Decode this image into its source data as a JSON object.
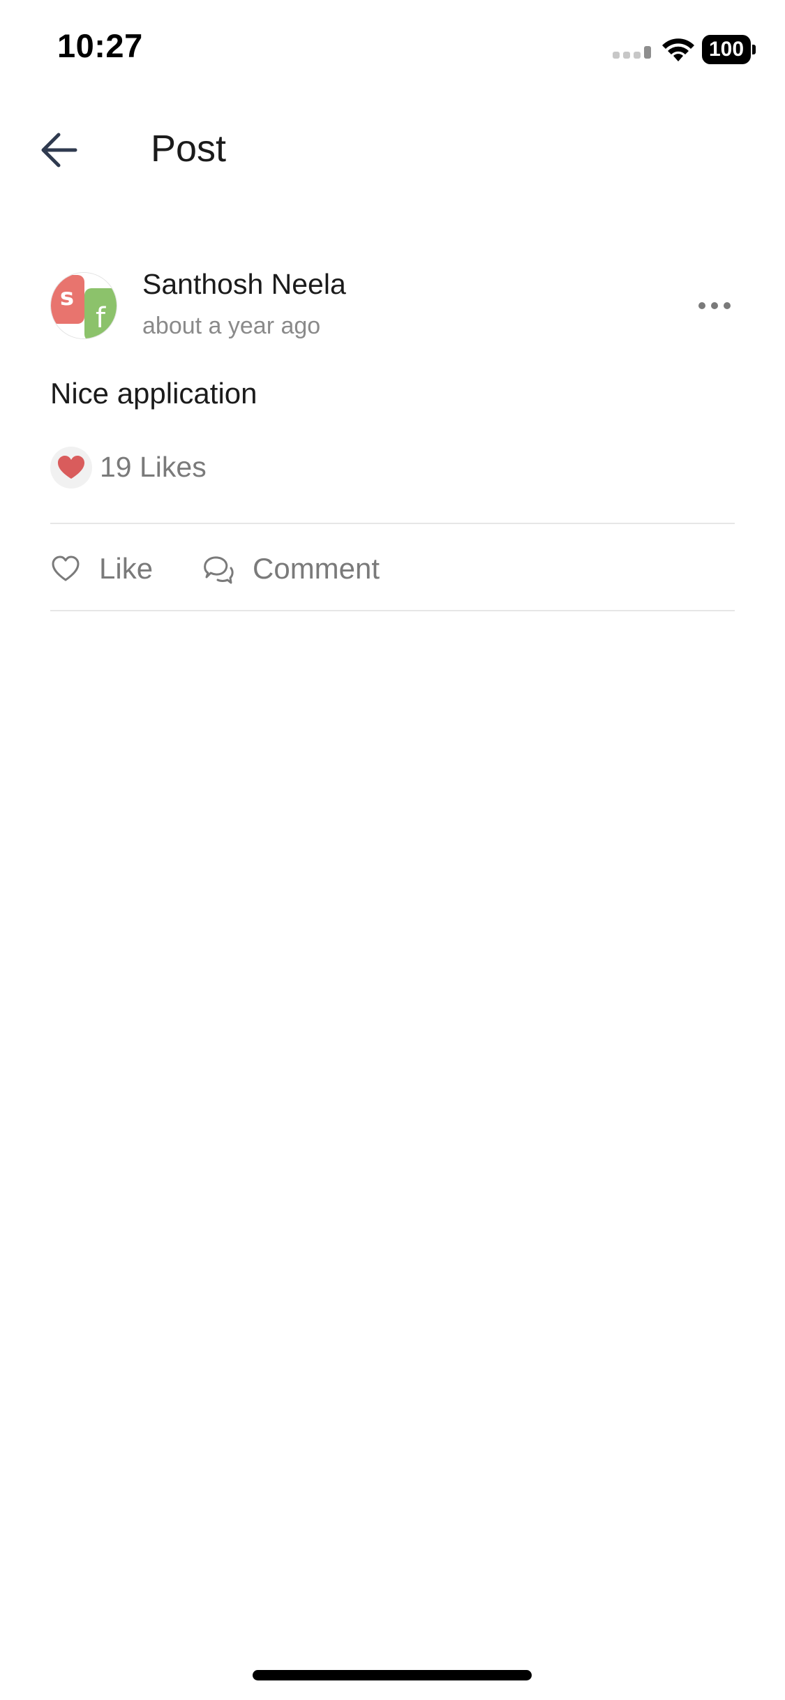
{
  "status_bar": {
    "time": "10:27",
    "battery": "100"
  },
  "header": {
    "title": "Post",
    "back_icon": "arrow-left-icon"
  },
  "post": {
    "author": "Santhosh Neela",
    "timestamp": "about a year ago",
    "text": "Nice application",
    "likes_label": "19 Likes",
    "more_icon": "more-horizontal-icon"
  },
  "actions": {
    "like_label": "Like",
    "comment_label": "Comment"
  },
  "colors": {
    "heart_red": "#d95c5c",
    "avatar_red": "#e8746e",
    "avatar_green": "#8cc26b",
    "muted_text": "#7a7a7a",
    "back_arrow": "#2f3a4f"
  }
}
